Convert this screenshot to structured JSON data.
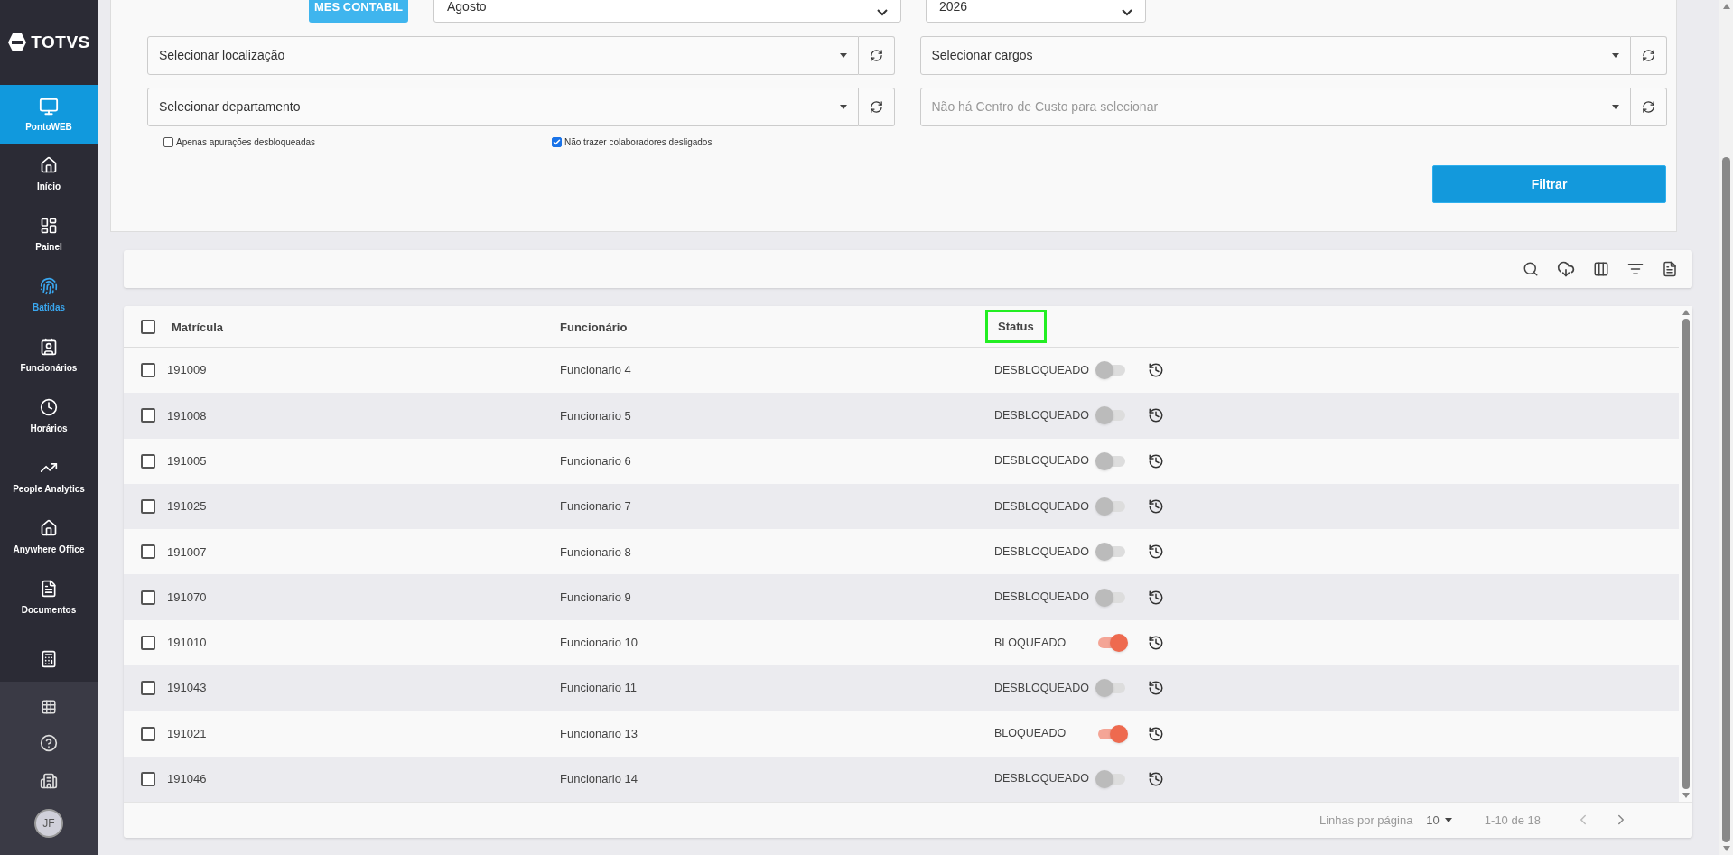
{
  "sidebar": {
    "logo": "TOTVS",
    "app": {
      "label": "PontoWEB"
    },
    "items": [
      {
        "label": "Início",
        "selected": false
      },
      {
        "label": "Painel",
        "selected": false
      },
      {
        "label": "Batidas",
        "selected": true
      },
      {
        "label": "Funcionários",
        "selected": false
      },
      {
        "label": "Horários",
        "selected": false
      },
      {
        "label": "People Analytics",
        "selected": false
      },
      {
        "label": "Anywhere Office",
        "selected": false
      },
      {
        "label": "Documentos",
        "selected": false
      },
      {
        "selected": false
      }
    ],
    "avatar": "JF"
  },
  "filters": {
    "period_button": "MES CONTABIL",
    "month": "Agosto",
    "year": "2026",
    "selects": [
      {
        "placeholder": "Selecionar localização",
        "disabled": false
      },
      {
        "placeholder": "Selecionar cargos",
        "disabled": false
      },
      {
        "placeholder": "Selecionar departamento",
        "disabled": false
      },
      {
        "placeholder": "Não há Centro de Custo para selecionar",
        "disabled": true
      }
    ],
    "checkboxes": [
      {
        "label": "Apenas apurações desbloqueadas",
        "checked": false
      },
      {
        "label": "Não trazer colaboradores desligados",
        "checked": true
      }
    ],
    "submit": "Filtrar"
  },
  "table": {
    "select_all_checked": false,
    "columns": [
      {
        "label": "Matrícula",
        "highlighted": false
      },
      {
        "label": "Funcionário",
        "highlighted": false
      },
      {
        "label": "Status",
        "highlighted": true
      }
    ],
    "rows": [
      {
        "matricula": "191009",
        "funcionario": "Funcionario 4",
        "status": "DESBLOQUEADO",
        "locked": false,
        "checked": false
      },
      {
        "matricula": "191008",
        "funcionario": "Funcionario 5",
        "status": "DESBLOQUEADO",
        "locked": false,
        "checked": false
      },
      {
        "matricula": "191005",
        "funcionario": "Funcionario 6",
        "status": "DESBLOQUEADO",
        "locked": false,
        "checked": false
      },
      {
        "matricula": "191025",
        "funcionario": "Funcionario 7",
        "status": "DESBLOQUEADO",
        "locked": false,
        "checked": false
      },
      {
        "matricula": "191007",
        "funcionario": "Funcionario 8",
        "status": "DESBLOQUEADO",
        "locked": false,
        "checked": false
      },
      {
        "matricula": "191070",
        "funcionario": "Funcionario 9",
        "status": "DESBLOQUEADO",
        "locked": false,
        "checked": false
      },
      {
        "matricula": "191010",
        "funcionario": "Funcionario 10",
        "status": "BLOQUEADO",
        "locked": true,
        "checked": false
      },
      {
        "matricula": "191043",
        "funcionario": "Funcionario 11",
        "status": "DESBLOQUEADO",
        "locked": false,
        "checked": false
      },
      {
        "matricula": "191021",
        "funcionario": "Funcionario 13",
        "status": "BLOQUEADO",
        "locked": true,
        "checked": false
      },
      {
        "matricula": "191046",
        "funcionario": "Funcionario 14",
        "status": "DESBLOQUEADO",
        "locked": false,
        "checked": false
      }
    ],
    "pagination": {
      "rows_label": "Linhas por página",
      "rows_per_page": "10",
      "range": "1-10 de 18"
    }
  }
}
